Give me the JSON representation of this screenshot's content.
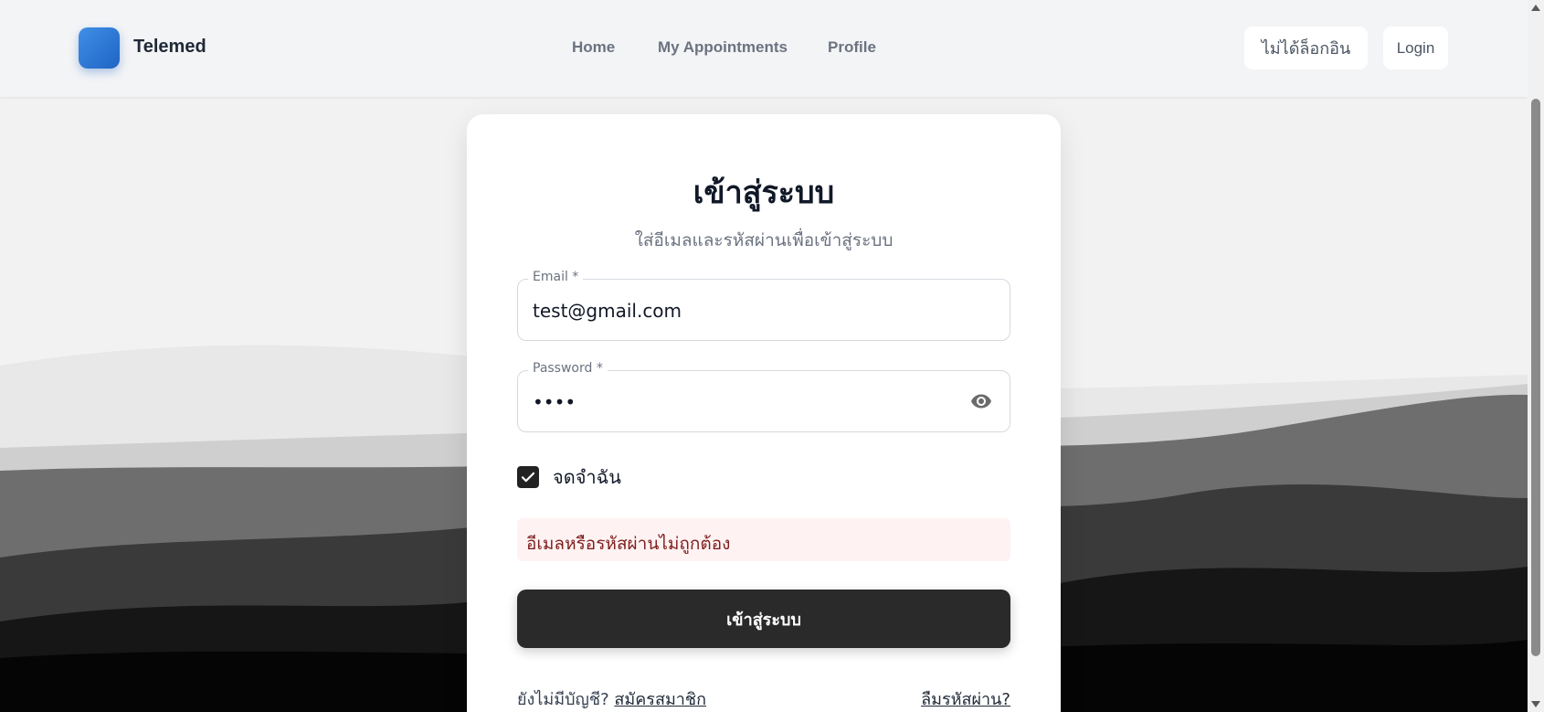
{
  "header": {
    "brand": "Telemed",
    "nav": {
      "home": "Home",
      "appointments": "My Appointments",
      "profile": "Profile"
    },
    "status_label": "ไม่ได้ล็อกอิน",
    "login_label": "Login"
  },
  "login_card": {
    "title": "เข้าสู่ระบบ",
    "subtitle": "ใส่อีเมลและรหัสผ่านเพื่อเข้าสู่ระบบ",
    "email": {
      "label": "Email *",
      "value": "test@gmail.com"
    },
    "password": {
      "label": "Password *",
      "value": "••••"
    },
    "remember": {
      "label": "จดจำฉัน",
      "checked": true
    },
    "error_message": "อีเมลหรือรหัสผ่านไม่ถูกต้อง",
    "submit_label": "เข้าสู่ระบบ",
    "no_account_text": "ยังไม่มีบัญชี?",
    "register_link": "สมัครสมาชิก",
    "forgot_link": "ลืมรหัสผ่าน?"
  },
  "colors": {
    "brand_gradient_start": "#3f8fe6",
    "brand_gradient_end": "#1f64c4",
    "primary_button": "#2a2a2a",
    "error_background": "#fef3f2",
    "error_text": "#7f1d1d"
  },
  "icons": {
    "logo": "app-logo-icon",
    "password_toggle": "eye-icon",
    "checkbox": "checkmark-icon"
  }
}
